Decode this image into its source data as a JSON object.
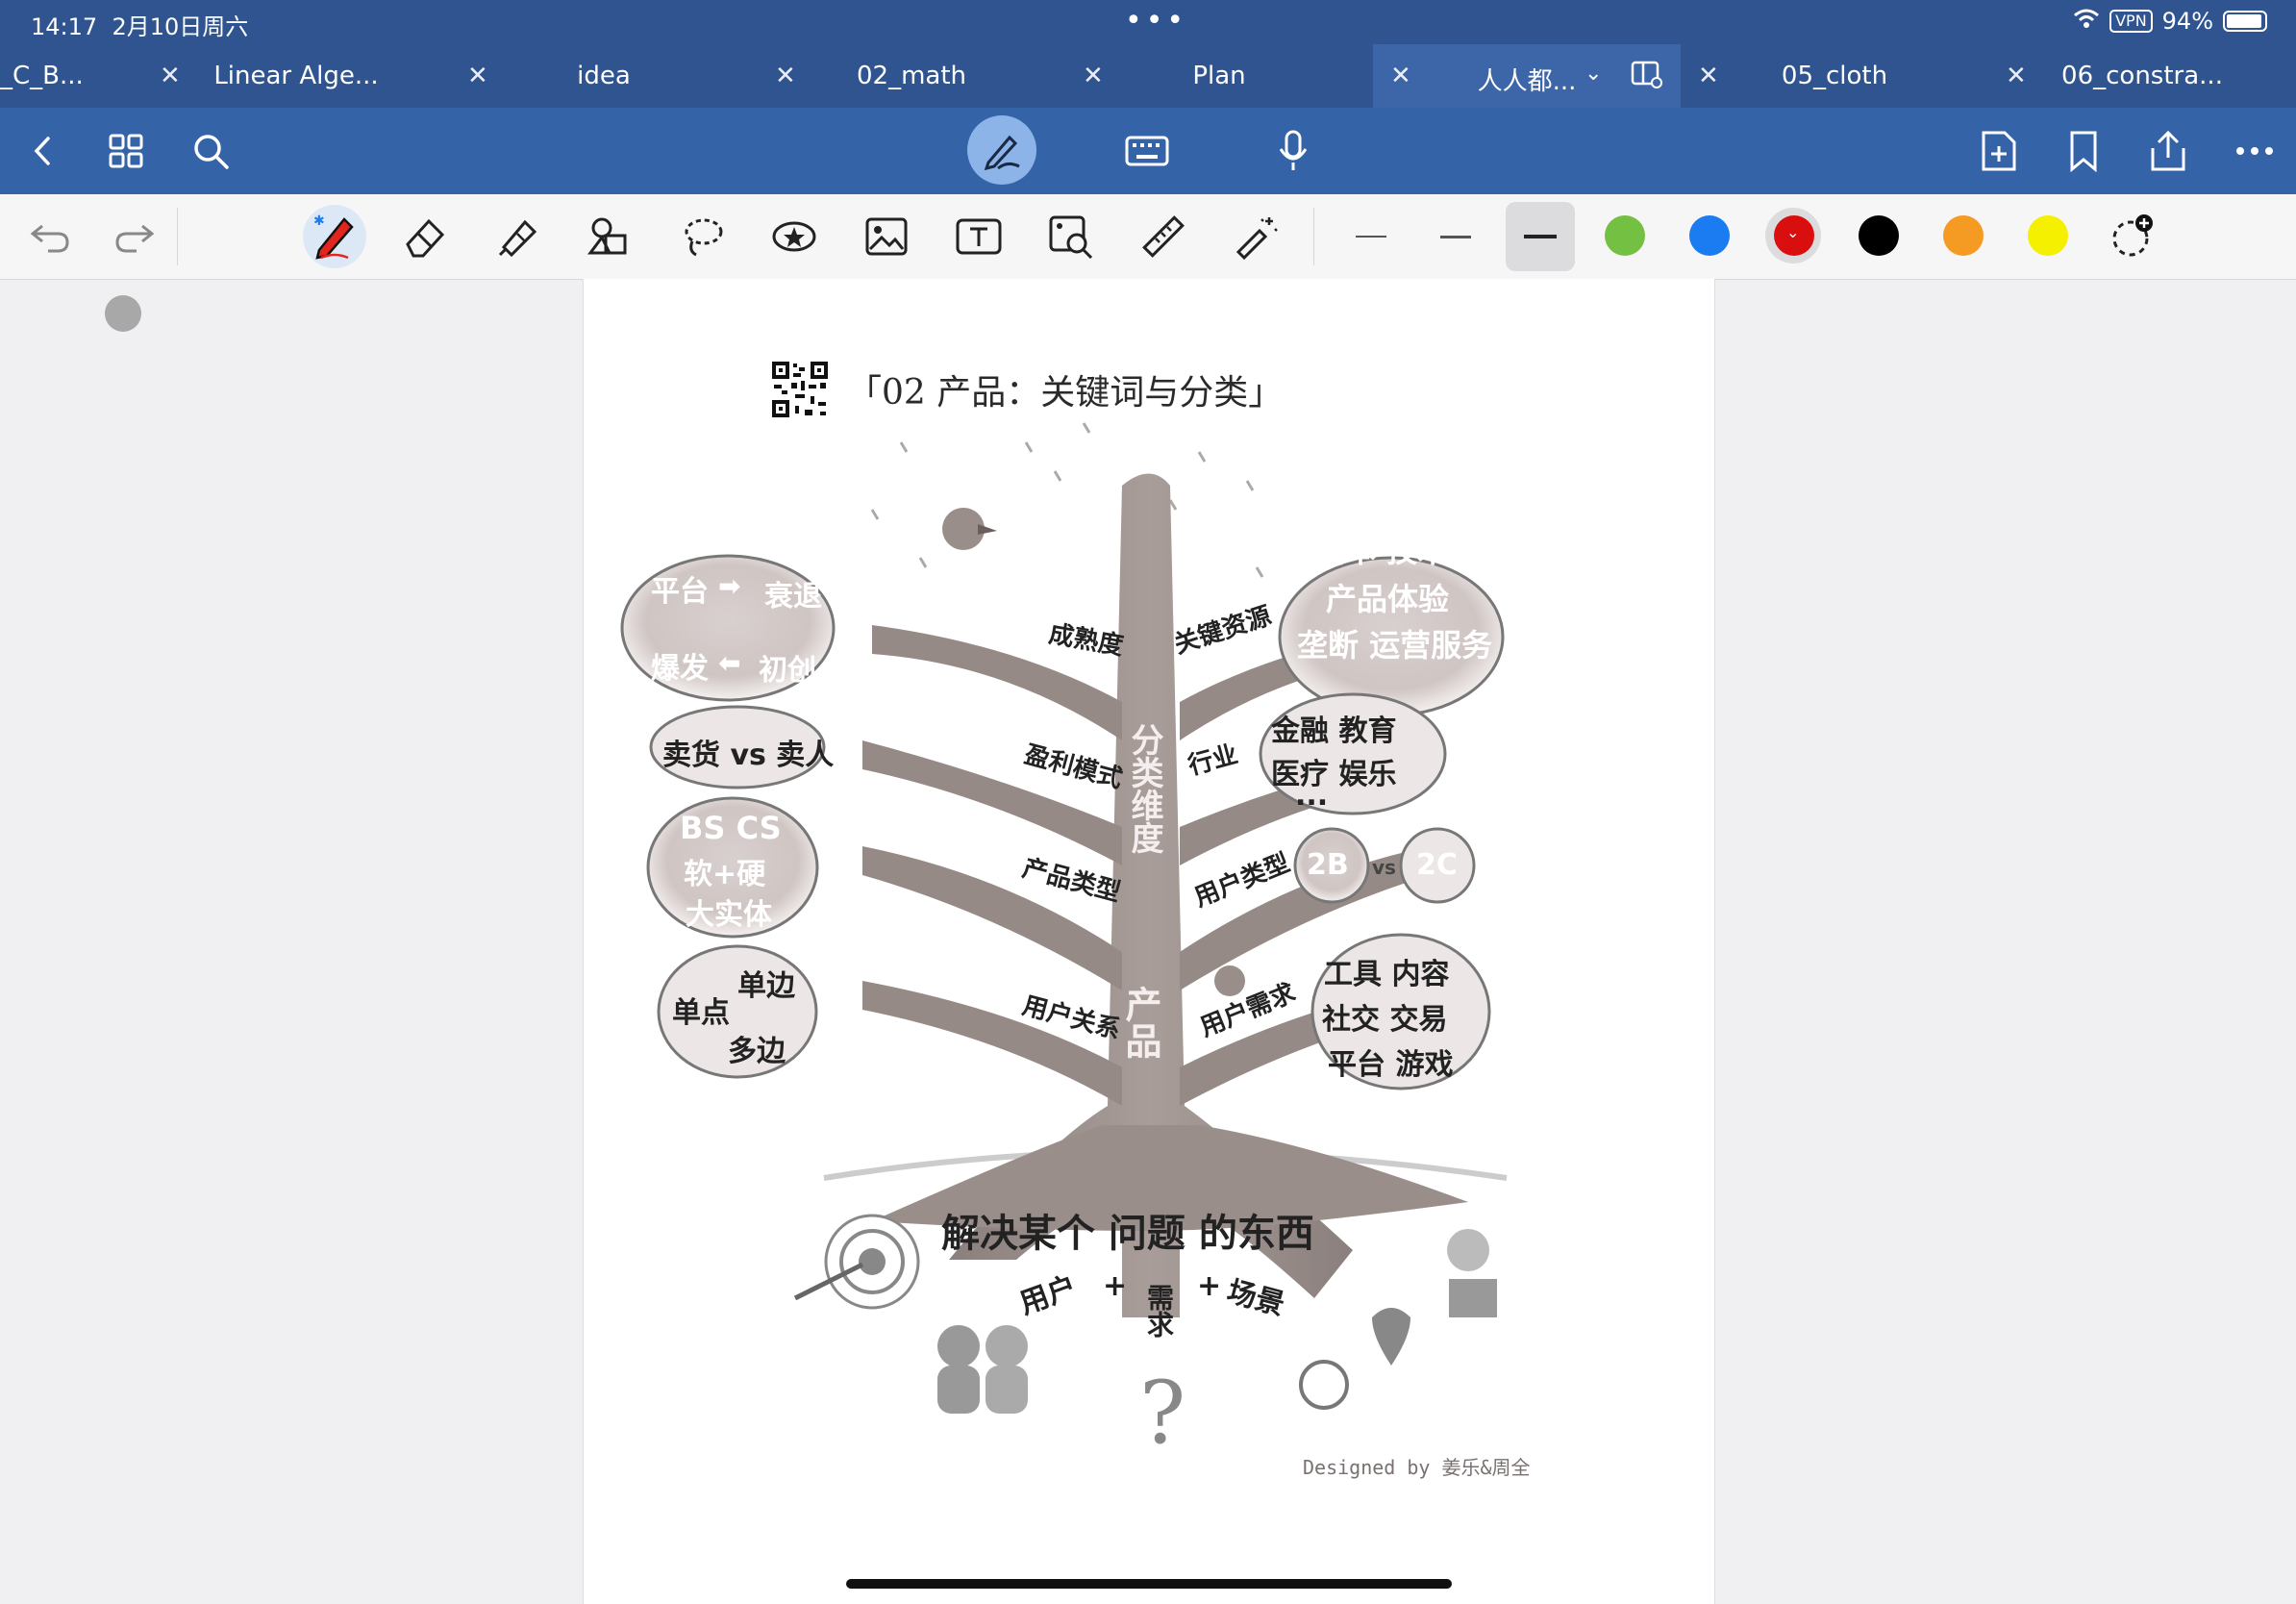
{
  "status": {
    "time": "14:17",
    "date": "2月10日周六",
    "vpn": "VPN",
    "battery": "94%"
  },
  "tabs": [
    {
      "label": "_C_B...",
      "active": false
    },
    {
      "label": "Linear Alge...",
      "active": false
    },
    {
      "label": "idea",
      "active": false
    },
    {
      "label": "02_math",
      "active": false
    },
    {
      "label": "Plan",
      "active": false
    },
    {
      "label": "人人都...",
      "active": true
    },
    {
      "label": "05_cloth",
      "active": false
    },
    {
      "label": "06_constra...",
      "active": false
    }
  ],
  "colors": {
    "blue": "#2f5490",
    "green": "#74c043",
    "sky": "#1a7cf0",
    "red": "#d90f0f",
    "black": "#000000",
    "orange": "#f59a23",
    "yellow": "#f5ef00"
  },
  "document": {
    "title": "「02 产品：关键词与分类」",
    "branches_left": [
      "成熟度",
      "盈利模式",
      "产品类型",
      "用户关系"
    ],
    "branches_right": [
      "关键资源",
      "行业",
      "用户类型",
      "用户需求"
    ],
    "trunk": [
      "分类维度",
      "产品"
    ],
    "bubble_lifecycle": [
      "平台",
      "衰退",
      "爆发",
      "初创"
    ],
    "bubble_resources": [
      "资本 技术",
      "产品体验",
      "垄断 运营服务"
    ],
    "bubble_profit": "卖货 vs 卖人",
    "bubble_industry": [
      "金融 教育",
      "医疗 娱乐",
      "..."
    ],
    "bubble_type": [
      "BS CS",
      "软+硬",
      "大实体"
    ],
    "bubble_user_type": [
      "2B",
      "vs",
      "2C"
    ],
    "bubble_relation": [
      "单点",
      "单边",
      "多边"
    ],
    "bubble_needs": [
      "工具 内容",
      "社交 交易",
      "平台 游戏"
    ],
    "root_main": "解决某个 问题 的东西",
    "root_bottom": [
      "用户",
      "+",
      "需求",
      "+",
      "场景"
    ],
    "credit": "Designed by 姜乐&周全"
  }
}
